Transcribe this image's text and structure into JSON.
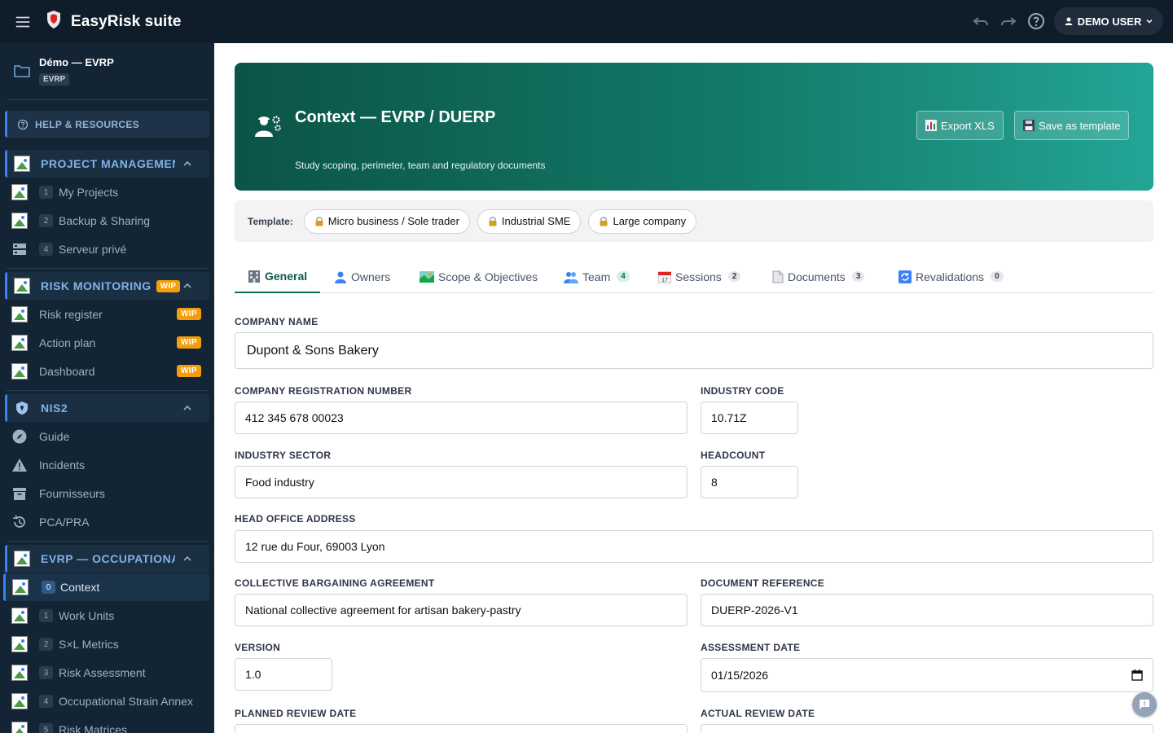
{
  "app": {
    "title": "EasyRisk suite"
  },
  "topbar": {
    "user_label": "DEMO USER"
  },
  "project": {
    "name": "Démo — EVRP",
    "badge": "EVRP"
  },
  "sidebar": {
    "help_label": "HELP & RESOURCES",
    "sections": [
      {
        "label": "PROJECT MANAGEMEN",
        "wip": "",
        "items": [
          {
            "num": "1",
            "label": "My Projects",
            "icon": "broken-image-icon"
          },
          {
            "num": "2",
            "label": "Backup & Sharing",
            "icon": "broken-image-icon"
          },
          {
            "num": "4",
            "label": "Serveur privé",
            "icon": "storage-icon"
          }
        ]
      },
      {
        "label": "RISK MONITORING",
        "wip": "WIP",
        "items": [
          {
            "label": "Risk register",
            "wip": "WIP",
            "icon": "broken-image-icon"
          },
          {
            "label": "Action plan",
            "wip": "WIP",
            "icon": "broken-image-icon"
          },
          {
            "label": "Dashboard",
            "wip": "WIP",
            "icon": "broken-image-icon"
          }
        ]
      },
      {
        "label": "NIS2",
        "items": [
          {
            "label": "Guide",
            "icon": "compass-icon"
          },
          {
            "label": "Incidents",
            "icon": "warning-icon"
          },
          {
            "label": "Fournisseurs",
            "icon": "archive-icon"
          },
          {
            "label": "PCA/PRA",
            "icon": "history-icon"
          }
        ]
      },
      {
        "label": "EVRP — OCCUPATIONAL",
        "items": [
          {
            "num": "0",
            "label": "Context",
            "active": true
          },
          {
            "num": "1",
            "label": "Work Units"
          },
          {
            "num": "2",
            "label": "S×L Metrics"
          },
          {
            "num": "3",
            "label": "Risk Assessment"
          },
          {
            "num": "4",
            "label": "Occupational Strain Annex"
          },
          {
            "num": "5",
            "label": "Risk Matrices"
          }
        ]
      }
    ]
  },
  "hero": {
    "title": "Context — EVRP / DUERP",
    "subtitle": "Study scoping, perimeter, team and regulatory documents",
    "export_label": "Export XLS",
    "save_label": "Save as template"
  },
  "templates": {
    "label": "Template:",
    "chips": [
      "Micro business / Sole trader",
      "Industrial SME",
      "Large company"
    ]
  },
  "tabs": [
    {
      "label": "General"
    },
    {
      "label": "Owners"
    },
    {
      "label": "Scope & Objectives"
    },
    {
      "label": "Team",
      "count": "4"
    },
    {
      "label": "Sessions",
      "count": "2"
    },
    {
      "label": "Documents",
      "count": "3"
    },
    {
      "label": "Revalidations",
      "count": "0"
    }
  ],
  "form": {
    "company_name": {
      "label": "COMPANY NAME",
      "value": "Dupont & Sons Bakery"
    },
    "registration": {
      "label": "COMPANY REGISTRATION NUMBER",
      "value": "412 345 678 00023"
    },
    "industry_code": {
      "label": "INDUSTRY CODE",
      "value": "10.71Z"
    },
    "sector": {
      "label": "INDUSTRY SECTOR",
      "value": "Food industry"
    },
    "headcount": {
      "label": "HEADCOUNT",
      "value": "8"
    },
    "address": {
      "label": "HEAD OFFICE ADDRESS",
      "value": "12 rue du Four, 69003 Lyon"
    },
    "cba": {
      "label": "COLLECTIVE BARGAINING AGREEMENT",
      "value": "National collective agreement for artisan bakery-pastry"
    },
    "doc_ref": {
      "label": "DOCUMENT REFERENCE",
      "value": "DUERP-2026-V1"
    },
    "version": {
      "label": "VERSION",
      "value": "1.0"
    },
    "assessment_date": {
      "label": "ASSESSMENT DATE",
      "value": "01/15/2026"
    },
    "planned_review": {
      "label": "PLANNED REVIEW DATE",
      "value": ""
    },
    "actual_review": {
      "label": "ACTUAL REVIEW DATE",
      "value": ""
    }
  },
  "colors": {
    "hero_start": "#0b5447",
    "hero_end": "#23a596",
    "accent": "#3b82f6",
    "wip": "#f59e0b"
  }
}
